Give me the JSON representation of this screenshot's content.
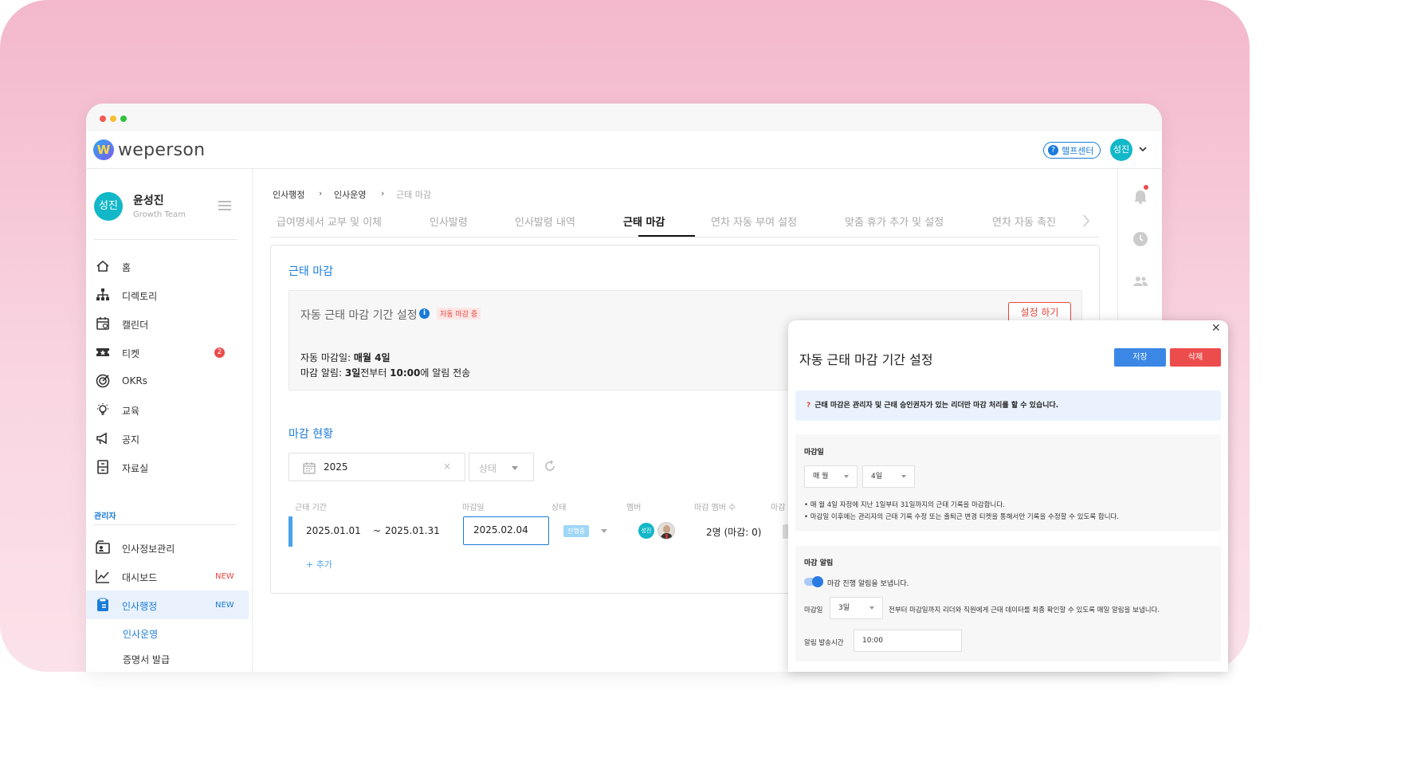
{
  "brand": {
    "name": "weperson",
    "logo_letter": "W"
  },
  "header": {
    "help_label": "헬프센터",
    "user_avatar": "성진"
  },
  "profile": {
    "avatar": "성진",
    "name": "윤성진",
    "team": "Growth Team"
  },
  "nav": [
    {
      "label": "홈",
      "icon": "home-icon"
    },
    {
      "label": "디렉토리",
      "icon": "org-chart-icon"
    },
    {
      "label": "캘린더",
      "icon": "calendar-icon"
    },
    {
      "label": "티켓",
      "icon": "ticket-icon",
      "badge": "2"
    },
    {
      "label": "OKRs",
      "icon": "target-icon"
    },
    {
      "label": "교육",
      "icon": "lightbulb-icon"
    },
    {
      "label": "공지",
      "icon": "megaphone-icon"
    },
    {
      "label": "자료실",
      "icon": "archive-icon"
    }
  ],
  "admin": {
    "section_label": "관리자",
    "items": [
      {
        "label": "인사정보관리",
        "icon": "id-card-icon",
        "tag": ""
      },
      {
        "label": "대시보드",
        "icon": "chart-line-icon",
        "tag": "NEW"
      },
      {
        "label": "인사행정",
        "icon": "hr-admin-icon",
        "tag": "NEW"
      }
    ],
    "sub_items": [
      "인사운영",
      "증명서 발급"
    ]
  },
  "breadcrumb": [
    "인사행정",
    "인사운영",
    "근태 마감"
  ],
  "tabs": [
    "급여명세서 교부 및 이체",
    "인사발령",
    "인사발령 내역",
    "근태 마감",
    "연차 자동 부여 설정",
    "맞춤 휴가 추가 및 설정",
    "연차 자동 촉진"
  ],
  "card": {
    "title": "근태 마감",
    "auto": {
      "title": "자동 근태 마감 기간 설정",
      "info": "i",
      "tag": "자동 마감 중",
      "button": "설정 하기",
      "line1_prefix": "자동 마감일: ",
      "line1_value": "매월 4일",
      "line2_prefix": "마감 알림: ",
      "line2_days": "3일",
      "line2_mid": "전부터 ",
      "line2_time": "10:00",
      "line2_suffix": "에 알림 전송"
    },
    "status_title": "마감 현황",
    "filter_year": "2025",
    "filter_status": "상태",
    "columns": [
      "근태 기간",
      "마감일",
      "상태",
      "멤버",
      "마감 멤버 수",
      "마감"
    ],
    "row": {
      "start": "2025.01.01",
      "tilde": "~",
      "end": "2025.01.31",
      "due": "2025.02.04",
      "status": "진행중",
      "member_avatar": "성진",
      "count": "2명 (마감: 0)"
    },
    "add": "+ 추가"
  },
  "modal": {
    "title": "자동 근태 마감 기간 설정",
    "save": "저장",
    "delete": "삭제",
    "note_mark": "?",
    "note": "근태 마감은 관리자 및 근태 승인권자가 있는 리더만 마감 처리를 할 수 있습니다.",
    "due_section": {
      "heading": "마감일",
      "period": "매 월",
      "day": "4일",
      "desc1": "• 매 월 4일 자정에 지난 1일부터 31일까지의 근태 기록을 마감합니다.",
      "desc2": "• 마감일 이후에는 관리자의 근태 기록 수정 또는 출퇴근 변경 티켓을 통해서만 기록을 수정할 수 있도록 합니다."
    },
    "alert_section": {
      "heading": "마감 알림",
      "toggle_label": "마감 진행 알림을 보냅니다.",
      "due_label": "마감일",
      "days": "3일",
      "days_desc": "전부터 마감일까지 리더와 직원에게 근태 데이터를 최종 확인할 수 있도록 매일 알림을 보냅니다.",
      "time_label": "알림 발송시간",
      "time": "10:00"
    }
  },
  "colors": {
    "accent": "#1a7bd8",
    "danger": "#e8453c",
    "avatar": "#12b8c8"
  }
}
